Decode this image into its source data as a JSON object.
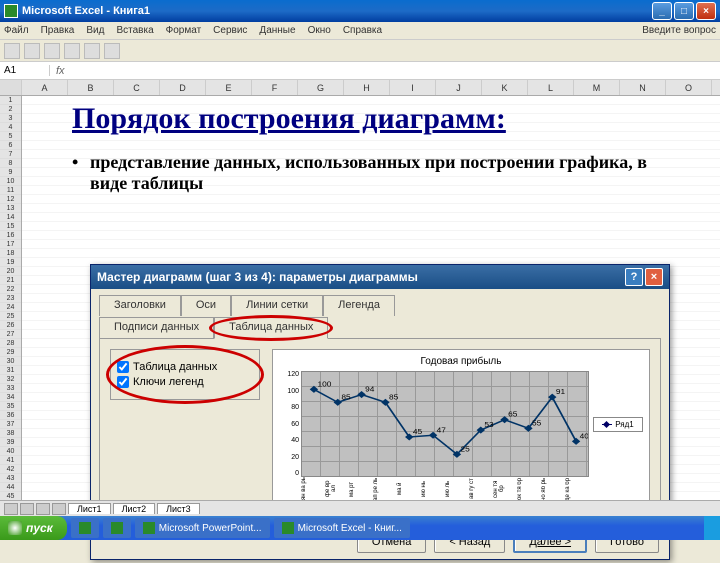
{
  "window": {
    "title": "Microsoft Excel - Книга1",
    "ask": "Введите вопрос"
  },
  "menu": [
    "Файл",
    "Правка",
    "Вид",
    "Вставка",
    "Формат",
    "Сервис",
    "Данные",
    "Окно",
    "Справка"
  ],
  "namebox": "A1",
  "columns": [
    "A",
    "B",
    "C",
    "D",
    "E",
    "F",
    "G",
    "H",
    "I",
    "J",
    "K",
    "L",
    "M",
    "N",
    "O"
  ],
  "slide": {
    "title": "Порядок построения диаграмм:",
    "bullet": "представление данных, использованных при построении графика, в виде таблицы"
  },
  "dialog": {
    "title": "Мастер диаграмм (шаг 3 из 4): параметры диаграммы",
    "tabs": {
      "titles": "Заголовки",
      "axes": "Оси",
      "gridlines": "Линии сетки",
      "legend": "Легенда",
      "labels": "Подписи данных",
      "datatable": "Таблица данных"
    },
    "options": {
      "show_table": "Таблица данных",
      "legend_keys": "Ключи легенд"
    },
    "buttons": {
      "cancel": "Отмена",
      "back": "< Назад",
      "next": "Далее >",
      "finish": "Готово"
    }
  },
  "chart_data": {
    "type": "line",
    "title": "Годовая прибыль",
    "ylim": [
      0,
      120
    ],
    "yticks": [
      0,
      20,
      40,
      60,
      80,
      100,
      120
    ],
    "categories": [
      "ян\nва\nрь",
      "фе\nвр\nал",
      "ма\nрт",
      "ап\nре\nль",
      "ма\nй",
      "ию\nнь",
      "ию\nль",
      "ав\nгу\nст",
      "сен\nтя\nбр",
      "ок\nтя\nбр",
      "но\nяб\nрь",
      "де\nка\nбр"
    ],
    "series": [
      {
        "name": "Ряд1",
        "values": [
          100,
          85,
          94,
          85,
          45,
          47,
          25,
          53,
          65,
          55,
          91,
          40
        ]
      }
    ],
    "xlabel": "",
    "ylabel": ""
  },
  "sheets": {
    "s1": "Лист1",
    "s2": "Лист2",
    "s3": "Лист3"
  },
  "taskbar": {
    "start": "пуск",
    "tasks": [
      "",
      "",
      "Microsoft PowerPoint...",
      "Microsoft Excel - Книг..."
    ]
  }
}
